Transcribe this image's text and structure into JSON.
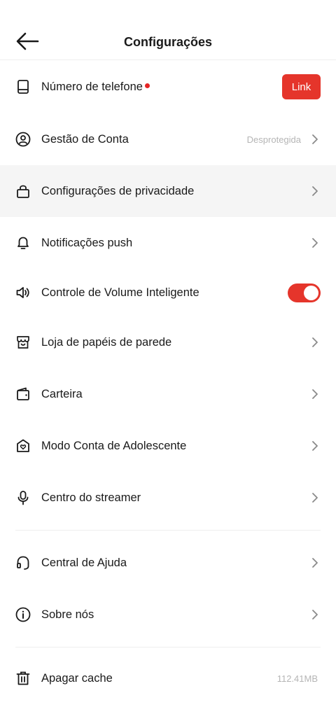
{
  "header": {
    "title": "Configurações",
    "back_icon": "arrow-left-icon"
  },
  "items": [
    {
      "label": "Número de telefone",
      "icon": "phone-icon",
      "has_dot": true,
      "button": "Link"
    },
    {
      "label": "Gestão de Conta",
      "icon": "user-circle-icon",
      "value": "Desprotegida"
    },
    {
      "label": "Configurações de privacidade",
      "icon": "lock-icon"
    },
    {
      "label": "Notificações push",
      "icon": "bell-icon"
    },
    {
      "label": "Controle de Volume Inteligente",
      "icon": "speaker-icon",
      "toggle_on": true
    },
    {
      "label": "Loja de papéis de parede",
      "icon": "store-icon"
    },
    {
      "label": "Carteira",
      "icon": "wallet-icon"
    },
    {
      "label": "Modo Conta de Adolescente",
      "icon": "shield-heart-icon"
    },
    {
      "label": "Centro do streamer",
      "icon": "microphone-icon"
    },
    {
      "label": "Central de Ajuda",
      "icon": "headset-icon"
    },
    {
      "label": "Sobre nós",
      "icon": "info-icon"
    },
    {
      "label": "Apagar cache",
      "icon": "trash-icon",
      "value": "112.41MB"
    }
  ],
  "colors": {
    "accent": "#e5352b",
    "dot": "#e52525",
    "highlight_row": "#f5f5f5"
  }
}
